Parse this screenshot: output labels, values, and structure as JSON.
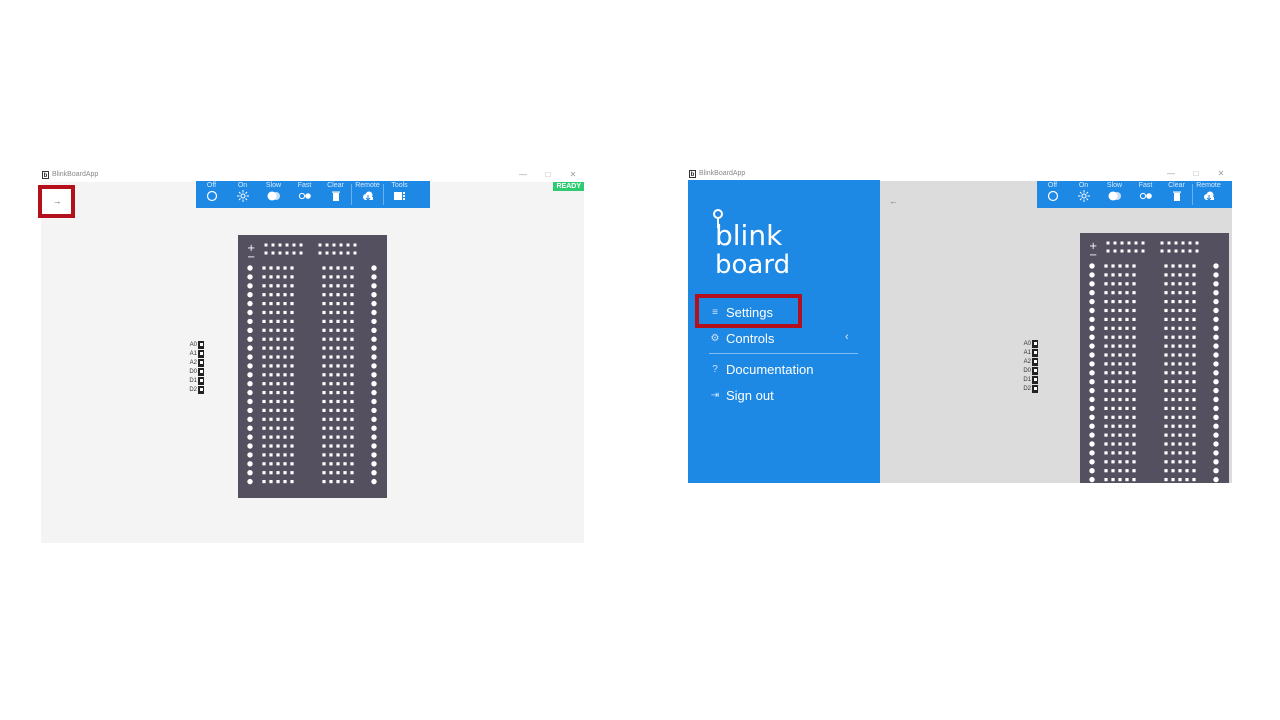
{
  "left_window": {
    "title": "BlinkBoardApp",
    "status_badge": "READY",
    "menu_toggle_glyph": "→",
    "toolbar": [
      {
        "label": "Off",
        "icon": "off-circle-icon"
      },
      {
        "label": "On",
        "icon": "sun-icon"
      },
      {
        "label": "Slow",
        "icon": "slow-icon"
      },
      {
        "label": "Fast",
        "icon": "fast-icon"
      },
      {
        "label": "Clear",
        "icon": "trash-icon"
      },
      {
        "label": "Remote",
        "icon": "cloud-icon"
      },
      {
        "label": "Tools",
        "icon": "tools-icon"
      }
    ],
    "pins": [
      "A0",
      "A1",
      "A2",
      "D0",
      "D1",
      "D2"
    ],
    "rail_signs": [
      "+",
      "−"
    ]
  },
  "right_window": {
    "title": "BlinkBoardApp",
    "back_glyph": "←",
    "logo": {
      "line1": "blink",
      "line2": "board"
    },
    "menu": [
      {
        "label": "Settings",
        "icon": "sliders-icon"
      },
      {
        "label": "Controls",
        "icon": "gear-icon"
      },
      {
        "label": "Documentation",
        "icon": "help-icon"
      },
      {
        "label": "Sign out",
        "icon": "sign-out-icon"
      }
    ],
    "toolbar": [
      {
        "label": "Off",
        "icon": "off-circle-icon"
      },
      {
        "label": "On",
        "icon": "sun-icon"
      },
      {
        "label": "Slow",
        "icon": "slow-icon"
      },
      {
        "label": "Fast",
        "icon": "fast-icon"
      },
      {
        "label": "Clear",
        "icon": "trash-icon"
      },
      {
        "label": "Remote",
        "icon": "cloud-icon"
      }
    ],
    "pins": [
      "A0",
      "A1",
      "A2",
      "D0",
      "D1",
      "D2"
    ],
    "rail_signs": [
      "+",
      "−"
    ]
  },
  "colors": {
    "accent": "#1e88e5",
    "board": "#545060",
    "highlight": "#b3101b",
    "ready": "#2ecc71"
  }
}
